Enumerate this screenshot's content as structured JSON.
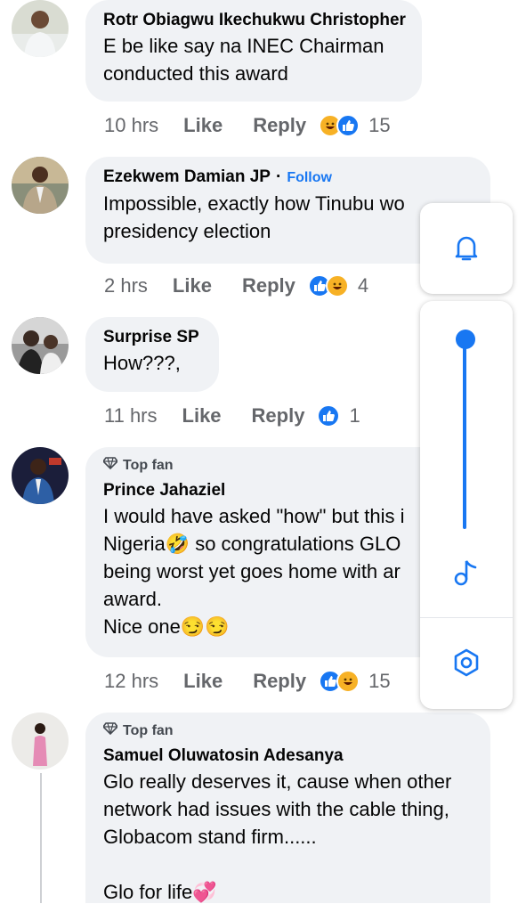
{
  "comments": [
    {
      "author": "Rotr Obiagwu Ikechukwu Christopher",
      "text": "E be like say na INEC Chairman\nconducted this award",
      "time": "10 hrs",
      "like_label": "Like",
      "reply_label": "Reply",
      "reaction_count": "15",
      "reactions": [
        "haha",
        "like"
      ]
    },
    {
      "author": "Ezekwem Damian JP",
      "separator": "·",
      "follow_label": "Follow",
      "text": "Impossible, exactly how Tinubu wo\npresidency election",
      "time": "2 hrs",
      "like_label": "Like",
      "reply_label": "Reply",
      "reaction_count": "4",
      "reactions": [
        "like",
        "haha"
      ]
    },
    {
      "author": "Surprise SP",
      "text": "How???,",
      "time": "11 hrs",
      "like_label": "Like",
      "reply_label": "Reply",
      "reaction_count": "1",
      "reactions": [
        "like"
      ]
    },
    {
      "badge": "Top fan",
      "author": "Prince Jahaziel",
      "text": "I would have asked \"how\" but this i\nNigeria🤣 so congratulations GLO\nbeing worst yet goes home with ar\naward.\nNice one😏😏",
      "time": "12 hrs",
      "like_label": "Like",
      "reply_label": "Reply",
      "reaction_count": "15",
      "reactions": [
        "like",
        "haha"
      ]
    },
    {
      "badge": "Top fan",
      "author": "Samuel Oluwatosin Adesanya",
      "text": "Glo really deserves it, cause when other\nnetwork had issues with the cable thing,\nGlobacom stand firm......\n\nGlo for life💞"
    }
  ],
  "floating_panel": {
    "icons": [
      "bell-icon",
      "music-note-icon",
      "hexagon-settings-icon"
    ],
    "slider_level": 1.0
  },
  "colors": {
    "accent": "#1877f2",
    "bubble": "#f0f2f5",
    "meta": "#65676b",
    "haha": "#f7b125"
  }
}
